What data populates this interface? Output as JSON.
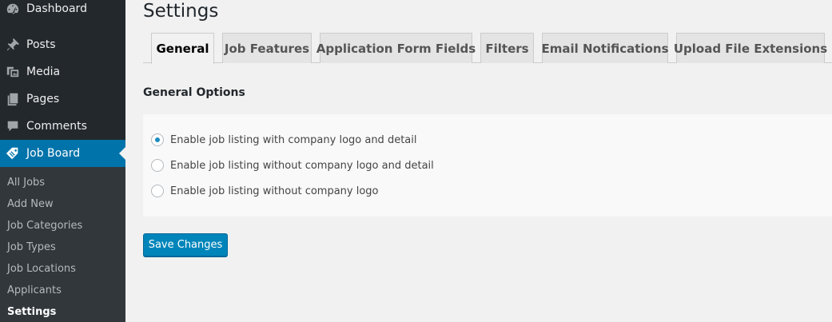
{
  "sidebar": {
    "menu": [
      {
        "label": "Dashboard",
        "icon": "dashboard-icon"
      },
      {
        "label": "Posts",
        "icon": "pin-icon"
      },
      {
        "label": "Media",
        "icon": "media-icon"
      },
      {
        "label": "Pages",
        "icon": "pages-icon"
      },
      {
        "label": "Comments",
        "icon": "comment-icon"
      },
      {
        "label": "Job Board",
        "icon": "tag-icon",
        "active": true
      }
    ],
    "submenu": [
      {
        "label": "All Jobs"
      },
      {
        "label": "Add New"
      },
      {
        "label": "Job Categories"
      },
      {
        "label": "Job Types"
      },
      {
        "label": "Job Locations"
      },
      {
        "label": "Applicants"
      },
      {
        "label": "Settings",
        "current": true
      }
    ]
  },
  "page": {
    "title": "Settings"
  },
  "tabs": [
    {
      "label": "General",
      "active": true
    },
    {
      "label": "Job Features"
    },
    {
      "label": "Application Form Fields"
    },
    {
      "label": "Filters"
    },
    {
      "label": "Email Notifications"
    },
    {
      "label": "Upload File Extensions"
    }
  ],
  "general": {
    "heading": "General Options",
    "options": [
      {
        "label": "Enable job listing with company logo and detail",
        "checked": true
      },
      {
        "label": "Enable job listing without company logo and detail",
        "checked": false
      },
      {
        "label": "Enable job listing without company logo",
        "checked": false
      }
    ]
  },
  "actions": {
    "save_label": "Save Changes"
  },
  "colors": {
    "sidebar_bg": "#23282d",
    "submenu_bg": "#32373c",
    "active_menu": "#0073aa",
    "primary_button": "#0085ba",
    "radio_dot": "#1e8cbe"
  }
}
